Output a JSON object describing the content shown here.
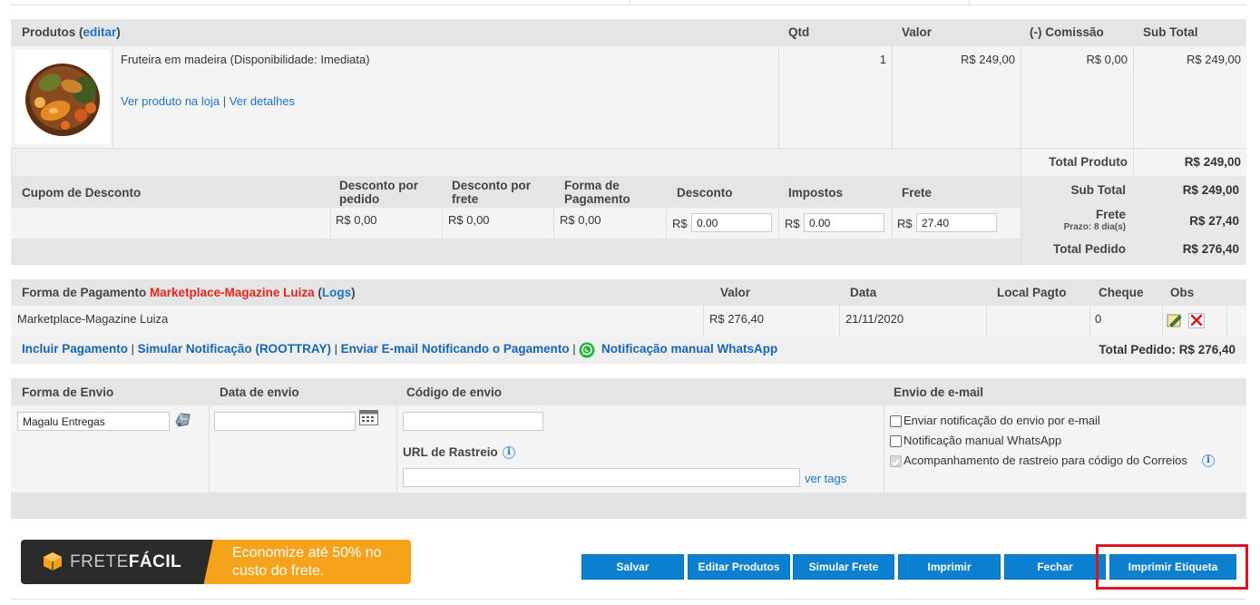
{
  "products": {
    "header": "Produtos",
    "edit_link": "editar",
    "col_qty": "Qtd",
    "col_value": "Valor",
    "col_commission": "(-) Comissão",
    "col_subtotal": "Sub Total",
    "item": {
      "name": "Fruteira em madeira (Disponibilidade: Imediata)",
      "view_store_link": "Ver produto na loja",
      "view_details_link": "Ver detalhes",
      "qty": "1",
      "value": "R$ 249,00",
      "commission": "R$ 0,00",
      "subtotal": "R$ 249,00"
    },
    "total_product_label": "Total Produto",
    "total_product_value": "R$ 249,00"
  },
  "discounts": {
    "col_coupon": "Cupom de Desconto",
    "col_order_discount_1": "Desconto por",
    "col_order_discount_2": "pedido",
    "col_freight_discount_1": "Desconto por",
    "col_freight_discount_2": "frete",
    "col_payment_form_1": "Forma de",
    "col_payment_form_2": "Pagamento",
    "col_discount": "Desconto",
    "col_taxes": "Impostos",
    "col_freight": "Frete",
    "order_discount": "R$ 0,00",
    "freight_discount": "R$ 0,00",
    "payment_discount": "R$ 0,00",
    "currency": "R$",
    "discount_value": "0.00",
    "taxes_value": "0.00",
    "freight_value": "27.40"
  },
  "summary": {
    "subtotal_label": "Sub Total",
    "subtotal_value": "R$ 249,00",
    "freight_label": "Frete",
    "freight_term": "Prazo: 8 dia(s)",
    "freight_value": "R$ 27,40",
    "order_total_label": "Total Pedido",
    "order_total_value": "R$ 276,40"
  },
  "payment": {
    "header_label": "Forma de Pagamento",
    "method_highlight": "Marketplace-Magazine Luiza",
    "logs_link": "Logs",
    "col_value": "Valor",
    "col_date": "Data",
    "col_local": "Local Pagto",
    "col_check": "Cheque",
    "col_obs": "Obs",
    "row": {
      "method": "Marketplace-Magazine Luiza",
      "value": "R$ 276,40",
      "date": "21/11/2020",
      "local": "",
      "check": "0"
    },
    "links": {
      "include": "Incluir Pagamento",
      "simulate": "Simular Notificação (ROOTTRAY)",
      "send_email": "Enviar E-mail Notificando o Pagamento",
      "whatsapp": "Notificação manual WhatsApp"
    },
    "total_label": "Total Pedido:",
    "total_value": "R$ 276,40"
  },
  "shipping": {
    "col_method": "Forma de Envio",
    "col_date": "Data de envio",
    "col_code": "Código de envio",
    "col_email": "Envio de e-mail",
    "method_value": "Magalu Entregas",
    "date_value": "",
    "code_value": "",
    "tracking_label": "URL de Rastreio",
    "tracking_value": "",
    "see_tags_link": "ver tags",
    "opt_notify_email": "Enviar notificação do envio por e-mail",
    "opt_whatsapp": "Notificação manual WhatsApp",
    "opt_tracking": "Acompanhamento de rastreio para código do Correios"
  },
  "banner": {
    "brand_left": "FRETE",
    "brand_right": "FÁCIL",
    "promo_line1": "Economize até 50% no",
    "promo_line2": "custo do frete."
  },
  "buttons": {
    "save": "Salvar",
    "edit_products": "Editar Produtos",
    "simulate_freight": "Simular Frete",
    "print": "Imprimir",
    "close": "Fechar",
    "print_label": "Imprimir Etiqueta"
  },
  "colors": {
    "button_blue": "#0b7fd0",
    "link_blue": "#1a73c7",
    "highlight_red": "#e8231d",
    "banner_orange": "#f7a21b",
    "banner_dark": "#2b2b2b",
    "annotation_red": "#e0141e"
  }
}
